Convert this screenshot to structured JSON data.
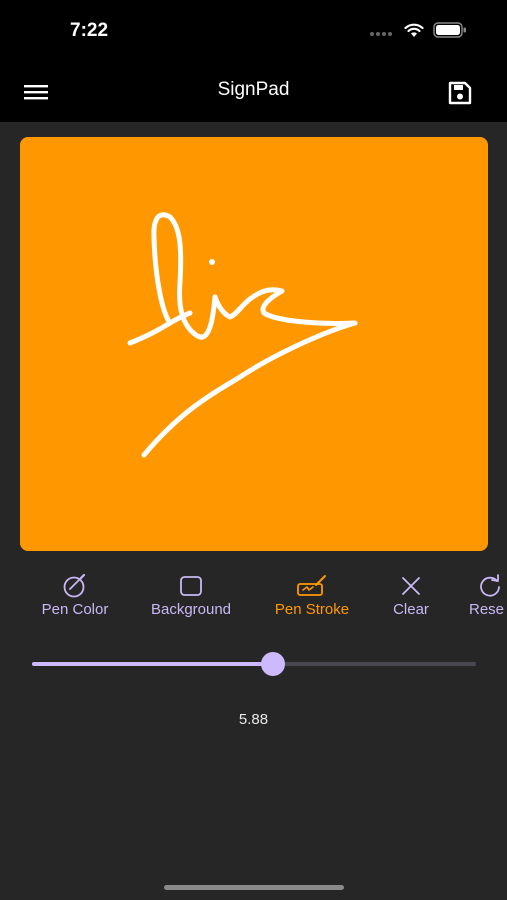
{
  "status": {
    "time": "7:22",
    "icons": [
      "signal-dots-icon",
      "wifi-icon",
      "battery-icon"
    ]
  },
  "app": {
    "title": "SignPad",
    "menu_icon": "hamburger-menu-icon",
    "save_icon": "save-icon"
  },
  "canvas": {
    "background_color": "#ff9800",
    "pen_color": "#ffffff"
  },
  "toolbar": {
    "items": [
      {
        "label": "Pen Color",
        "icon": "pen-color-icon"
      },
      {
        "label": "Background",
        "icon": "background-square-icon"
      },
      {
        "label": "Pen Stroke",
        "icon": "pen-stroke-icon",
        "active": true
      },
      {
        "label": "Clear",
        "icon": "close-icon"
      },
      {
        "label": "Rese",
        "icon": "reset-icon"
      }
    ]
  },
  "stroke": {
    "value": "5.88",
    "fraction": 0.543
  },
  "colors": {
    "accent": "#ff9800",
    "lilac": "#cdb9ff",
    "background": "#262626"
  }
}
